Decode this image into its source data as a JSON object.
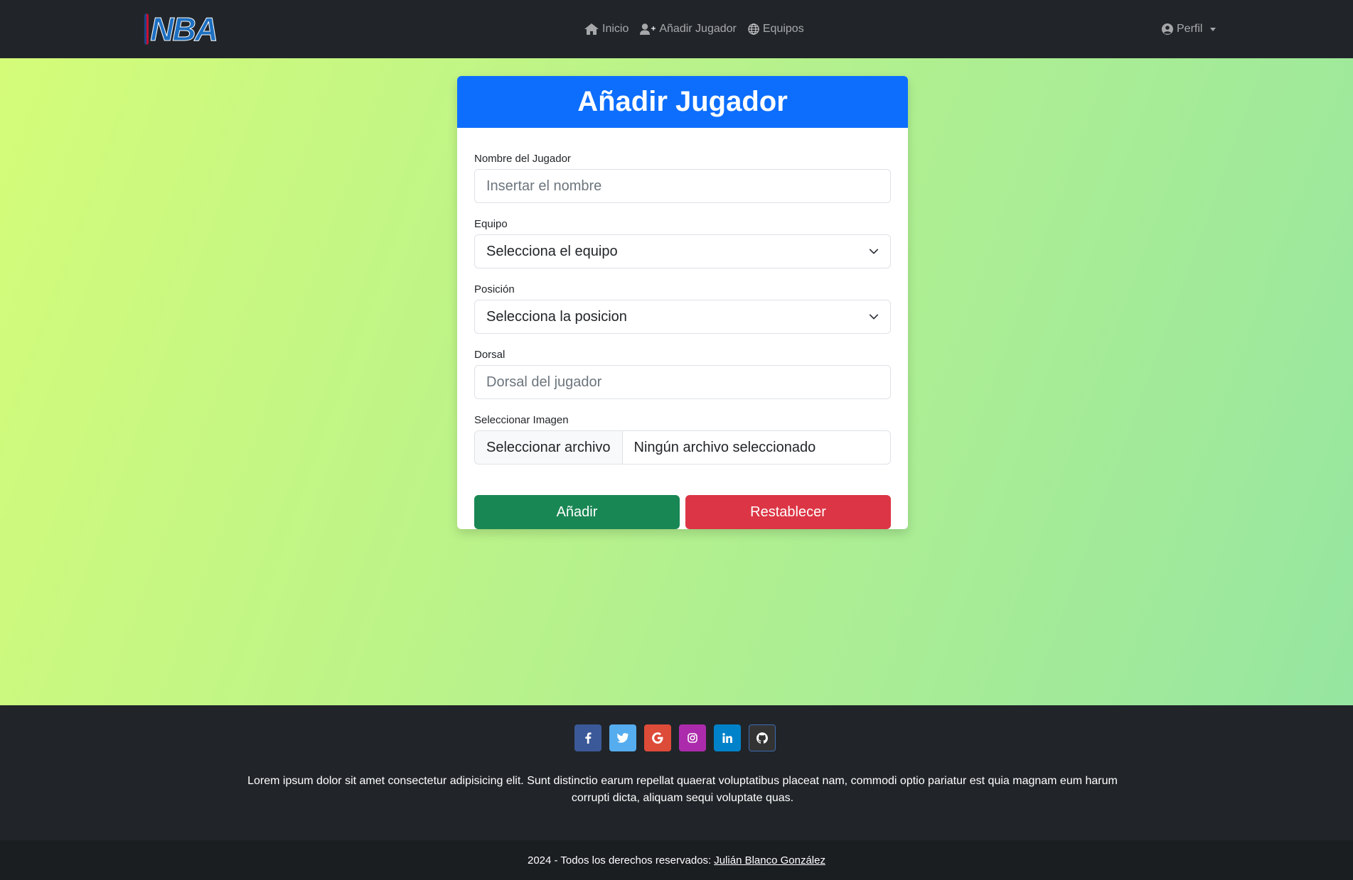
{
  "navbar": {
    "logo_text": "NBA",
    "links": [
      {
        "label": "Inicio",
        "icon": "home-icon"
      },
      {
        "label": "Añadir Jugador",
        "icon": "user-plus-icon"
      },
      {
        "label": "Equipos",
        "icon": "globe-icon"
      }
    ],
    "profile": {
      "label": "Perfil",
      "icon": "user-circle-icon"
    }
  },
  "form": {
    "title": "Añadir Jugador",
    "name": {
      "label": "Nombre del Jugador",
      "placeholder": "Insertar el nombre"
    },
    "team": {
      "label": "Equipo",
      "value": "Selecciona el equipo"
    },
    "position": {
      "label": "Posición",
      "value": "Selecciona la posicion"
    },
    "number": {
      "label": "Dorsal",
      "placeholder": "Dorsal del jugador"
    },
    "image": {
      "label": "Seleccionar Imagen",
      "button": "Seleccionar archivo",
      "status": "Ningún archivo seleccionado"
    },
    "submit_label": "Añadir",
    "reset_label": "Restablecer"
  },
  "footer": {
    "social": [
      {
        "name": "facebook",
        "glyph": "f",
        "color": "#3b5998"
      },
      {
        "name": "twitter",
        "glyph": "t",
        "color": "#55acee"
      },
      {
        "name": "google",
        "glyph": "G",
        "color": "#dd4b39"
      },
      {
        "name": "instagram",
        "glyph": "ig",
        "color": "#ac2bac"
      },
      {
        "name": "linkedin",
        "glyph": "in",
        "color": "#0082ca"
      },
      {
        "name": "github",
        "glyph": "gh",
        "color": "#333333"
      }
    ],
    "text": "Lorem ipsum dolor sit amet consectetur adipisicing elit. Sunt distinctio earum repellat quaerat voluptatibus placeat nam, commodi optio pariatur est quia magnam eum harum corrupti dicta, aliquam sequi voluptate quas.",
    "copyright_prefix": "2024 - Todos los derechos reservados:",
    "author": "Julián Blanco González"
  },
  "colors": {
    "primary": "#0d6efd",
    "success": "#198754",
    "danger": "#dc3545",
    "dark": "#212529"
  }
}
